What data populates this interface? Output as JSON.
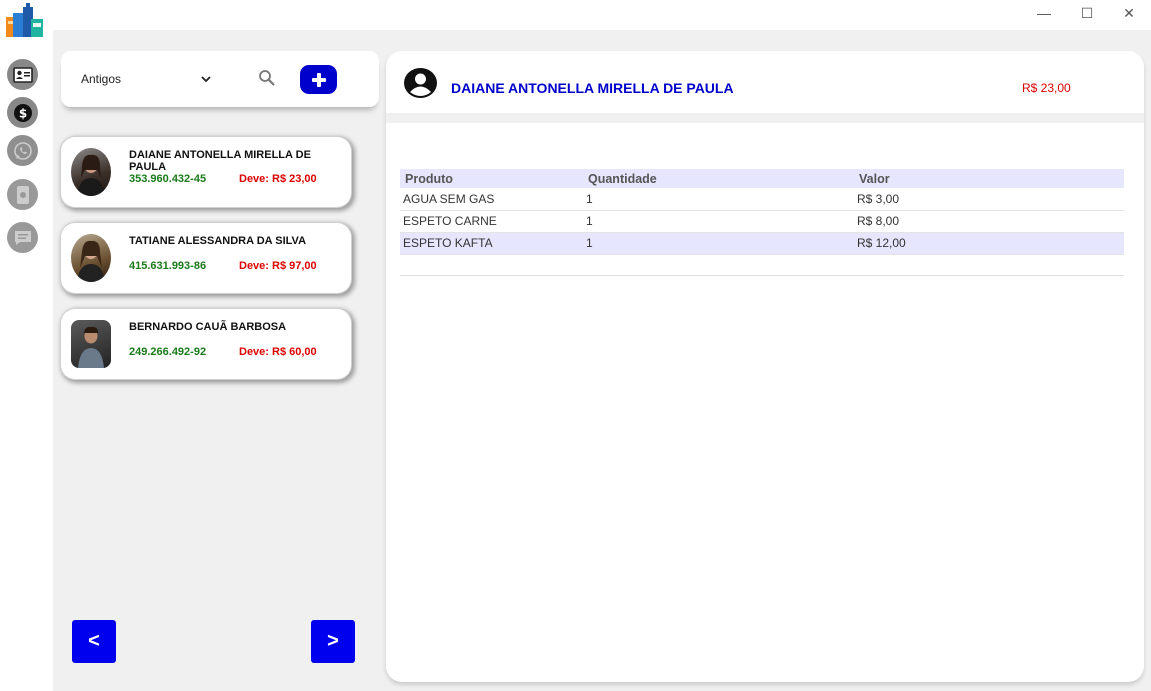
{
  "window": {
    "minimize": "—",
    "maximize": "☐",
    "close": "✕"
  },
  "sidebar": {
    "items": [
      {
        "icon": "contact-card-icon"
      },
      {
        "icon": "dollar-icon"
      },
      {
        "icon": "whatsapp-icon"
      },
      {
        "icon": "money-bill-icon"
      },
      {
        "icon": "chat-icon"
      }
    ]
  },
  "search": {
    "filter_value": "Antigos"
  },
  "clients": [
    {
      "name": "DAIANE ANTONELLA MIRELLA DE PAULA",
      "cpf": "353.960.432-45",
      "debt": "Deve: R$ 23,00"
    },
    {
      "name": "TATIANE ALESSANDRA DA SILVA",
      "cpf": "415.631.993-86",
      "debt": "Deve: R$ 97,00"
    },
    {
      "name": "BERNARDO CAUÃ BARBOSA",
      "cpf": "249.266.492-92",
      "debt": "Deve: R$ 60,00"
    }
  ],
  "pagination": {
    "prev": "<",
    "next": ">"
  },
  "detail": {
    "name": "DAIANE ANTONELLA MIRELLA DE PAULA",
    "total": "R$ 23,00",
    "columns": [
      "Produto",
      "Quantidade",
      "Valor"
    ],
    "rows": [
      {
        "produto": "AGUA SEM GAS",
        "quantidade": "1",
        "valor": "R$ 3,00"
      },
      {
        "produto": "ESPETO CARNE",
        "quantidade": "1",
        "valor": "R$ 8,00"
      },
      {
        "produto": "ESPETO KAFTA",
        "quantidade": "1",
        "valor": "R$ 12,00"
      }
    ]
  },
  "colors": {
    "accent": "#0000cc",
    "debt": "#dd0000",
    "cpf": "#1a7a1a",
    "row_highlight": "#e6e6ff"
  }
}
